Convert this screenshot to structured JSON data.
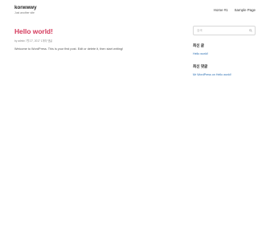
{
  "site": {
    "title": "korwwwy",
    "tagline": "Just another site"
  },
  "nav": {
    "items": [
      {
        "label": "Home #1"
      },
      {
        "label": "Sample Page"
      }
    ]
  },
  "post": {
    "title": "Hello world!",
    "meta": "by admin  7월 27, 2017  1개의 댓글",
    "body": "Welcome to WordPress. This is your first post. Edit or delete it, then start writing!"
  },
  "sidebar": {
    "search": {
      "placeholder": "검색"
    },
    "recent_posts": {
      "title": "최신 글",
      "items": [
        "Hello world!"
      ]
    },
    "recent_comments": {
      "title": "최신 댓글",
      "items": [
        "Mr WordPress on Hello world!"
      ]
    }
  }
}
